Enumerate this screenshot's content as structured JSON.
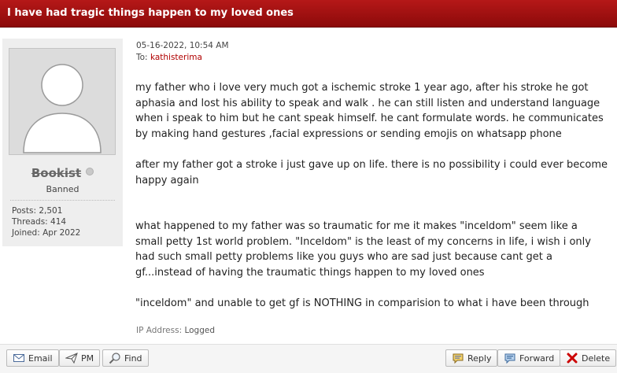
{
  "thread": {
    "title": "I have had tragic things happen to my loved ones"
  },
  "author": {
    "username": "Bookist",
    "role": "Banned",
    "stats": {
      "posts": "Posts: 2,501",
      "threads": "Threads: 414",
      "joined": "Joined: Apr 2022"
    }
  },
  "post": {
    "date": "05-16-2022, 10:54 AM",
    "to_label": "To:",
    "to_user": "kathisterima",
    "paragraphs": [
      "my father who i love very much got a ischemic stroke 1 year ago, after his stroke he got aphasia and lost his ability to speak and walk . he can still listen and understand language when i speak to him but he cant speak himself. he cant formulate words. he communicates by making hand gestures ,facial expressions or sending emojis on whatsapp phone",
      "after my father got a stroke i just gave up on life. there is no possibility i could ever become happy again",
      "what happened to my father was so traumatic for me it makes \"inceldom\" seem like a small petty 1st world problem. \"Inceldom\" is the least of my concerns in life, i wish i only had such small petty problems like you guys who are sad just because cant get a gf...instead of having the traumatic things happen to my loved ones",
      "\"inceldom\" and unable to get gf is NOTHING in comparision to what i have been through"
    ],
    "ip_label": "IP Address:",
    "ip_value": "Logged"
  },
  "footer": {
    "email": "Email",
    "pm": "PM",
    "find": "Find",
    "reply": "Reply",
    "forward": "Forward",
    "delete": "Delete"
  },
  "icons": [
    "envelope-icon",
    "paper-plane-icon",
    "magnifier-icon",
    "reply-icon",
    "forward-icon",
    "delete-x-icon",
    "offline-status-icon",
    "avatar-placeholder"
  ],
  "colors": {
    "title_bar": "#a50f0f",
    "link": "#b00000",
    "delete": "#cc0000"
  }
}
